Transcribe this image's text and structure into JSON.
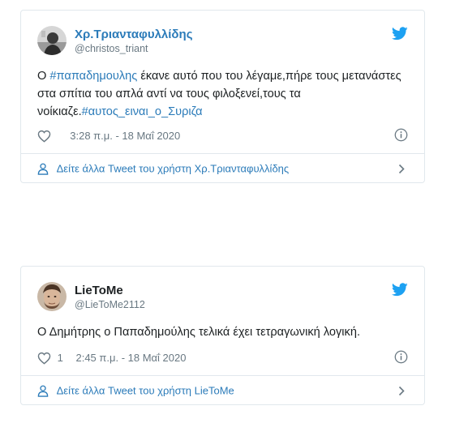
{
  "tweets": [
    {
      "display_name": "Χρ.Τριανταφυλλίδης",
      "handle": "@christos_triant",
      "text_parts": {
        "p1": "Ο ",
        "tag1": "#παπαδημουλης",
        "p2": " έκανε αυτό που του λέγαμε,πήρε τους μετανάστες στα σπίτια του απλά αντί να τους φιλοξενεί,τους τα νοίκιαζε.",
        "tag2": "#αυτος_ειναι_ο_Συριζα"
      },
      "like_count": "",
      "time": "3:28 π.μ. - 18 Μαΐ 2020",
      "more_link": "Δείτε άλλα Tweet του χρήστη Χρ.Τριανταφυλλίδης"
    },
    {
      "display_name": "LieToMe",
      "handle": "@LieToMe2112",
      "text": "Ο Δημήτρης ο Παπαδημούλης τελικά έχει τετραγωνική λογική.",
      "like_count": "1",
      "time": "2:45 π.μ. - 18 Μαΐ 2020",
      "more_link": "Δείτε άλλα Tweet του χρήστη LieToMe"
    }
  ],
  "colors": {
    "link": "#2b7bb9",
    "twitter_blue": "#1da1f2",
    "text": "#1c2022",
    "muted": "#697882",
    "border": "#e1e8ed"
  },
  "icons": {
    "brand": "twitter-bird-icon",
    "like": "heart-icon",
    "info": "info-icon",
    "profile": "person-icon",
    "arrow": "chevron-right-icon"
  }
}
